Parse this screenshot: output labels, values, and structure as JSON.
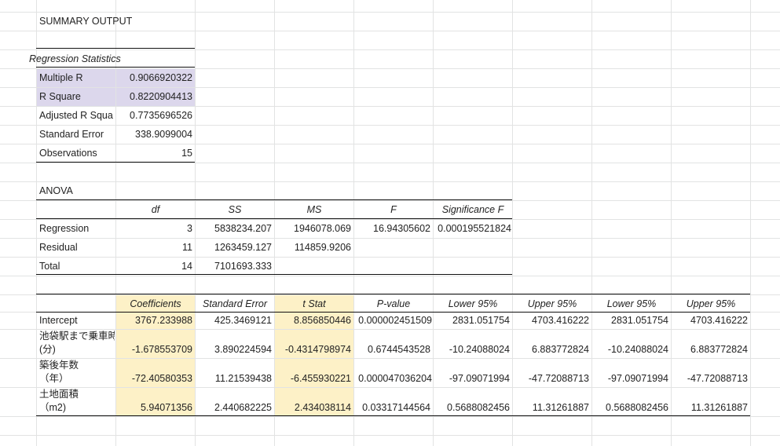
{
  "summary_title": "SUMMARY OUTPUT",
  "regression_statistics": {
    "title": "Regression Statistics",
    "rows": [
      {
        "label": "Multiple R",
        "value": "0.9066920322"
      },
      {
        "label": "R Square",
        "value": "0.8220904413"
      },
      {
        "label": "Adjusted R Squa",
        "value": "0.7735696526"
      },
      {
        "label": "Standard Error",
        "value": "338.9099004"
      },
      {
        "label": "Observations",
        "value": "15"
      }
    ]
  },
  "anova": {
    "title": "ANOVA",
    "headers": [
      "df",
      "SS",
      "MS",
      "F",
      "Significance F"
    ],
    "rows": [
      {
        "label": "Regression",
        "df": "3",
        "ss": "5838234.207",
        "ms": "1946078.069",
        "f": "16.94305602",
        "sig": "0.000195521824"
      },
      {
        "label": "Residual",
        "df": "11",
        "ss": "1263459.127",
        "ms": "114859.9206"
      },
      {
        "label": "Total",
        "df": "14",
        "ss": "7101693.333"
      }
    ]
  },
  "coefficients": {
    "headers": [
      "Coefficients",
      "Standard Error",
      "t Stat",
      "P-value",
      "Lower 95%",
      "Upper 95%",
      "Lower 95%",
      "Upper 95%"
    ],
    "rows": [
      {
        "label1": "Intercept",
        "label2": "",
        "values": [
          "3767.233988",
          "425.3469121",
          "8.856850446",
          "0.000002451509",
          "2831.051754",
          "4703.416222",
          "2831.051754",
          "4703.416222"
        ]
      },
      {
        "label1": "池袋駅まで乗車時",
        "label2": "(分)",
        "values": [
          "-1.678553709",
          "3.890224594",
          "-0.4314798974",
          "0.6744543528",
          "-10.24088024",
          "6.883772824",
          "-10.24088024",
          "6.883772824"
        ]
      },
      {
        "label1": "築後年数",
        "label2": "（年）",
        "values": [
          "-72.40580353",
          "11.21539438",
          "-6.455930221",
          "0.000047036204",
          "-97.09071994",
          "-47.72088713",
          "-97.09071994",
          "-47.72088713"
        ]
      },
      {
        "label1": "土地面積",
        "label2": "（m2)",
        "values": [
          "5.94071356",
          "2.440682225",
          "2.434038114",
          "0.03317144564",
          "0.5688082456",
          "11.31261887",
          "0.5688082456",
          "11.31261887"
        ]
      }
    ]
  }
}
